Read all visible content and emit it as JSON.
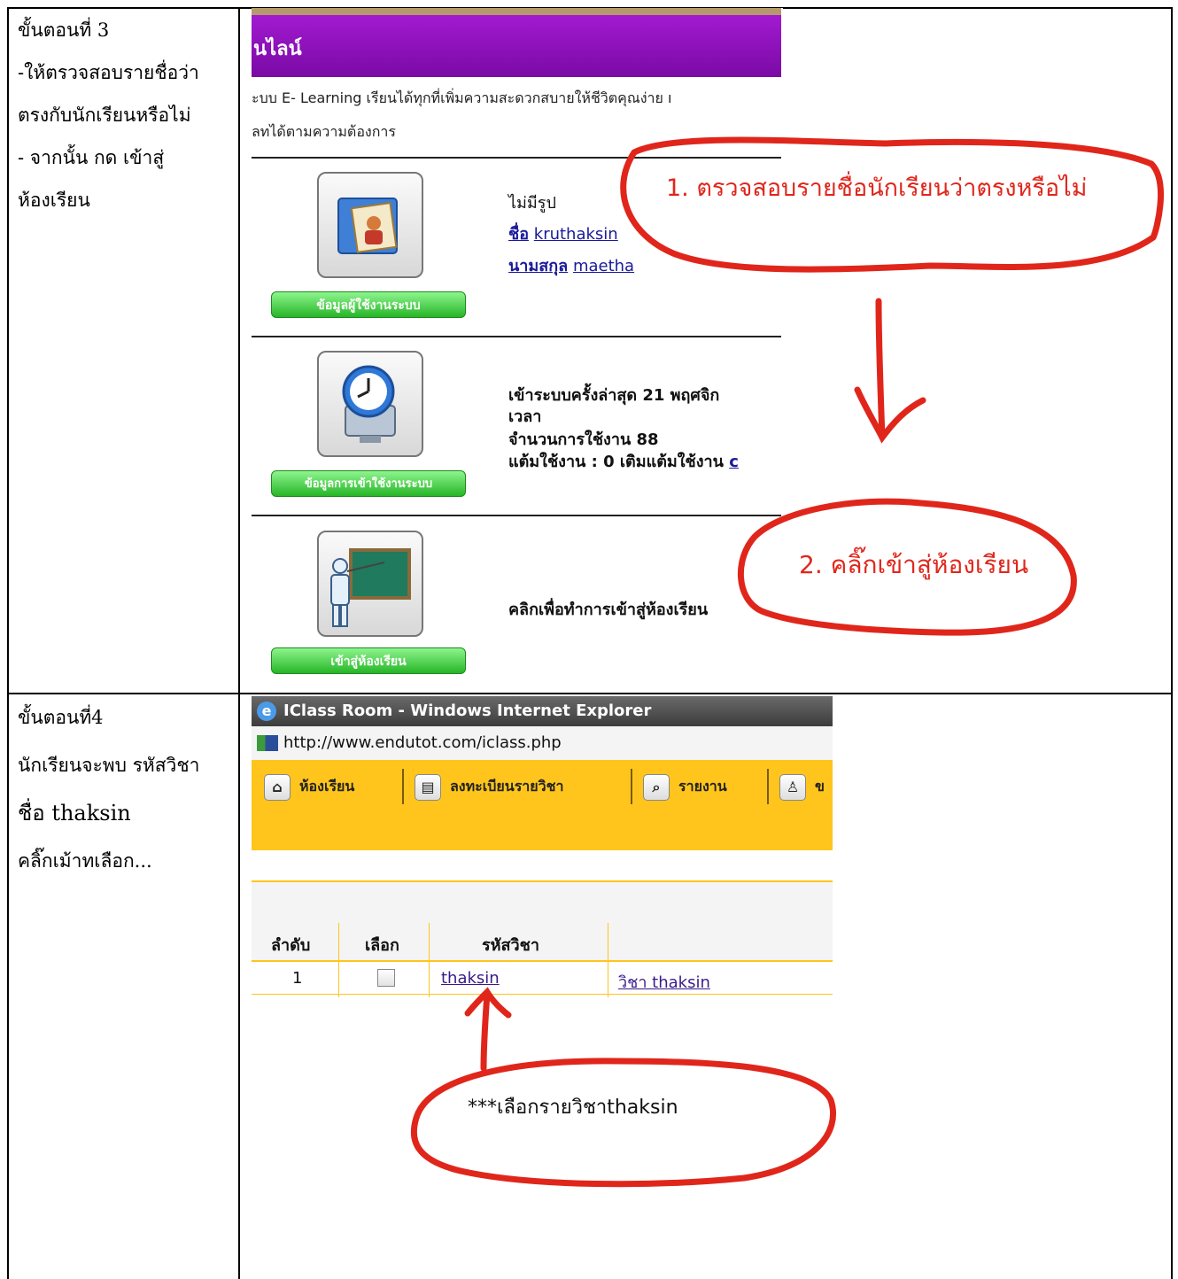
{
  "step3": {
    "title": "ขั้นตอนที่  3",
    "lines": [
      "-ให้ตรวจสอบรายชื่อว่า",
      "ตรงกับนักเรียนหรือไม่",
      "- จากนั้น กด เข้าสู่",
      "ห้องเรียน"
    ],
    "screenshot": {
      "header_text": "นไลน์",
      "desc_line1": "ะบบ E- Learning เรียนได้ทุกที่เพิ่มความสะดวกสบายให้ชีวิตคุณง่าย ı",
      "desc_line2": "ลทได้ตามความต้องการ",
      "user_button": "ข้อมูลผู้ใช้งานระบบ",
      "no_photo": "ไม่มีรูป",
      "name_label": "ชื่อ",
      "name_value": "kruthaksin",
      "surname_label": "นามสกุล",
      "surname_value": "maetha",
      "access_button": "ข้อมูลการเข้าใช้งานระบบ",
      "last_login": "เข้าระบบครั้งล่าสุด 21 พฤศจิก",
      "time_label": "เวลา",
      "usage_count": "จำนวนการใช้งาน 88",
      "points": "แต้มใช้งาน : 0 เติมแต้มใช้งาน",
      "points_link": "c",
      "enter_button": "เข้าสู่ห้องเรียน",
      "enter_text": "คลิกเพื่อทำการเข้าสู่ห้องเรียน"
    },
    "annotation1": "1. ตรวจสอบรายชื่อนักเรียนว่าตรงหรือไม่",
    "annotation2": "2. คลิ๊กเข้าสู่ห้องเรียน"
  },
  "step4": {
    "title": "ขั้นตอนที่4",
    "lines": [
      "นักเรียนจะพบ รหัสวิชา",
      "ชื่อ thaksin",
      "คลิ๊กเม้าทเลือก..."
    ],
    "screenshot": {
      "window_title": "IClass Room - Windows Internet Explorer",
      "url": "http://www.endutot.com/iclass.php",
      "nav": [
        "ห้องเรียน",
        "ลงทะเบียนรายวิชา",
        "รายงาน",
        "ข"
      ],
      "columns": [
        "ลำดับ",
        "เลือก",
        "รหัสวิชา"
      ],
      "row": {
        "no": "1",
        "code": "thaksin",
        "name": "วิชา thaksin"
      }
    },
    "annotation": "***เลือกรายวิชาthaksin"
  },
  "colors": {
    "annotation_red": "#e0261b",
    "header_purple": "#8e12bd",
    "nav_yellow": "#ffc51c",
    "button_green": "#27b527"
  }
}
